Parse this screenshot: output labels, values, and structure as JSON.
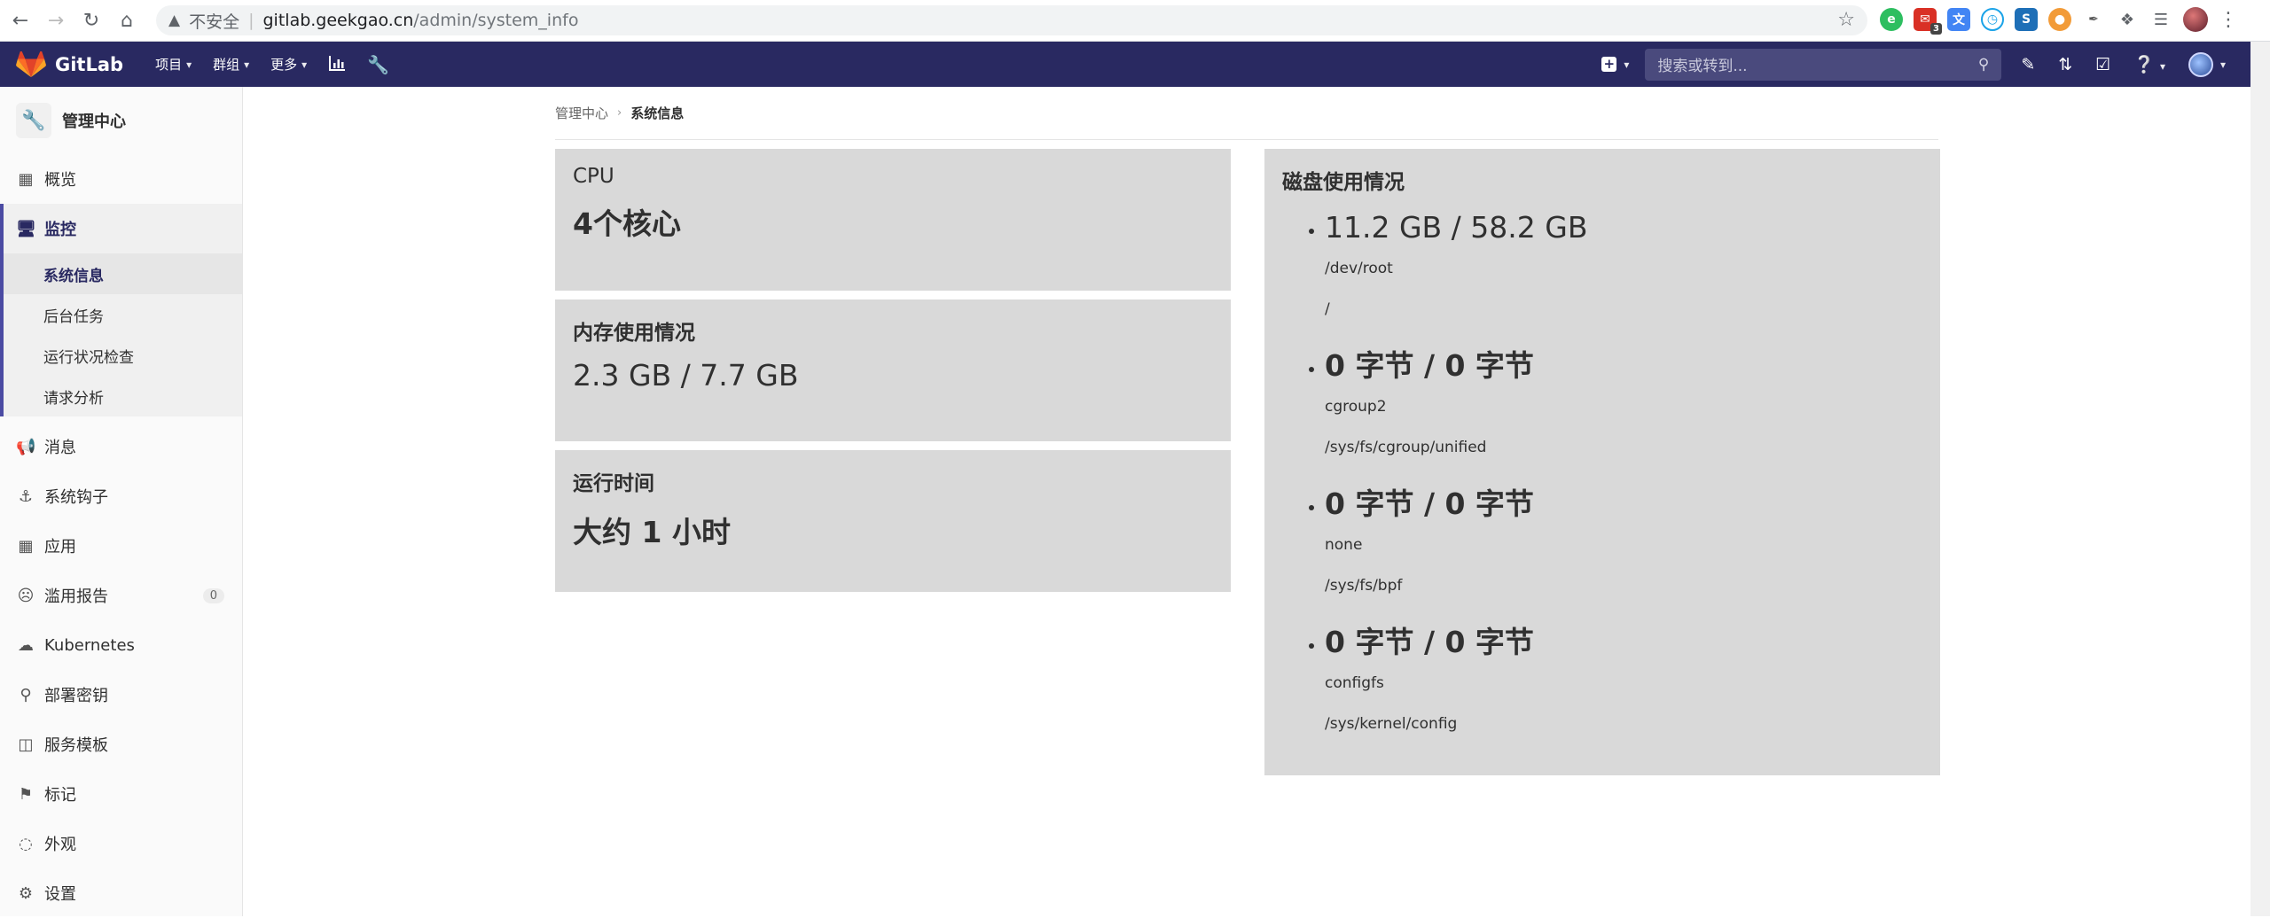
{
  "browser": {
    "insecure_label": "不安全",
    "url_host": "gitlab.geekgao.cn",
    "url_path": "/admin/system_info",
    "extension_badge": "3"
  },
  "topnav": {
    "brand": "GitLab",
    "menu": [
      {
        "label": "项目"
      },
      {
        "label": "群组"
      },
      {
        "label": "更多"
      }
    ],
    "search_placeholder": "搜索或转到..."
  },
  "sidebar": {
    "title": "管理中心",
    "items_top": [
      {
        "label": "概览",
        "icon": "overview-icon"
      }
    ],
    "monitoring": {
      "label": "监控",
      "subitems": [
        {
          "label": "系统信息"
        },
        {
          "label": "后台任务"
        },
        {
          "label": "运行状况检查"
        },
        {
          "label": "请求分析"
        }
      ]
    },
    "items_bottom": [
      {
        "label": "消息",
        "icon": "megaphone-icon"
      },
      {
        "label": "系统钩子",
        "icon": "hook-icon"
      },
      {
        "label": "应用",
        "icon": "applications-icon"
      },
      {
        "label": "滥用报告",
        "icon": "abuse-icon",
        "count": "0"
      },
      {
        "label": "Kubernetes",
        "icon": "cloud-icon"
      },
      {
        "label": "部署密钥",
        "icon": "key-icon"
      },
      {
        "label": "服务模板",
        "icon": "template-icon"
      },
      {
        "label": "标记",
        "icon": "label-icon"
      },
      {
        "label": "外观",
        "icon": "appearance-icon"
      },
      {
        "label": "设置",
        "icon": "settings-icon"
      }
    ]
  },
  "breadcrumb": {
    "parent": "管理中心",
    "current": "系统信息"
  },
  "cpu": {
    "title": "CPU",
    "value": "4个核心"
  },
  "memory": {
    "title": "内存使用情况",
    "value": "2.3 GB / 7.7 GB"
  },
  "uptime": {
    "title": "运行时间",
    "value": "大约 1 小时"
  },
  "disk": {
    "title": "磁盘使用情况",
    "entries": [
      {
        "usage": "11.2 GB / 58.2 GB",
        "device": "/dev/root",
        "mount": "/"
      },
      {
        "usage": "0 字节 / 0 字节",
        "device": "cgroup2",
        "mount": "/sys/fs/cgroup/unified"
      },
      {
        "usage": "0 字节 / 0 字节",
        "device": "none",
        "mount": "/sys/fs/bpf"
      },
      {
        "usage": "0 字节 / 0 字节",
        "device": "configfs",
        "mount": "/sys/kernel/config"
      }
    ]
  },
  "colors": {
    "topnav_bg": "#292961",
    "card_bg": "#d9d9d9",
    "sidebar_active": "#4b4ba3"
  }
}
